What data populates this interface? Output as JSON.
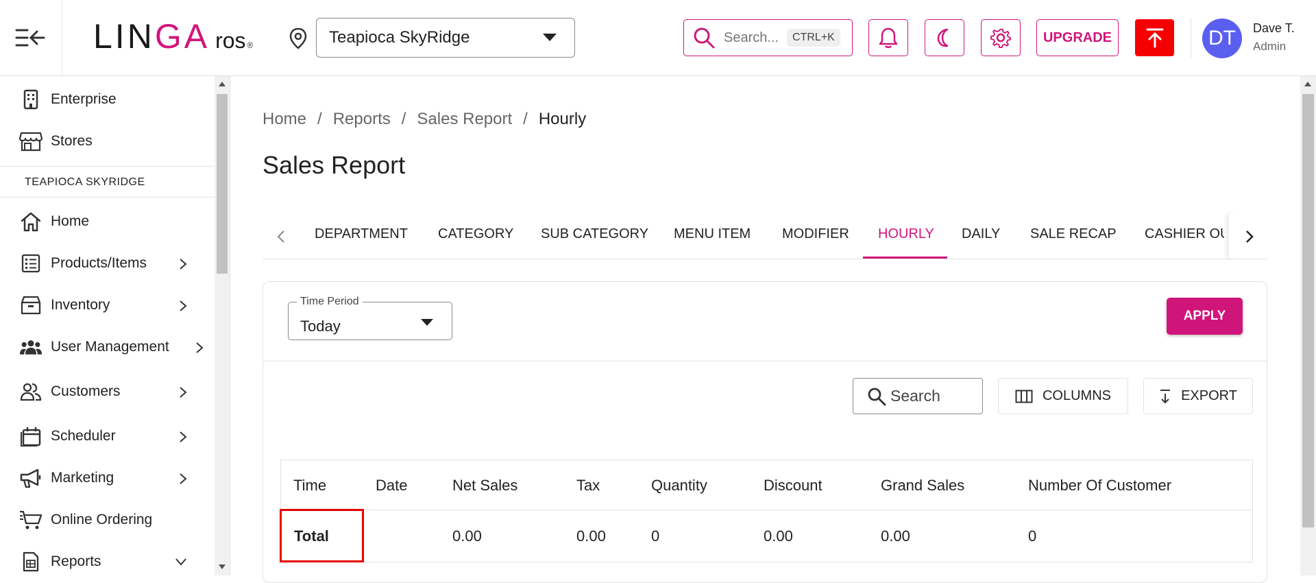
{
  "header": {
    "logo": {
      "brand_prefix": "LIN",
      "brand_accent": "GA",
      "product": "ros",
      "registered": "®"
    },
    "store_selector": {
      "value": "Teapioca SkyRidge"
    },
    "search": {
      "placeholder": "Search...",
      "shortcut": "CTRL+K"
    },
    "upgrade_label": "UPGRADE",
    "user": {
      "initials": "DT",
      "name": "Dave T.",
      "role": "Admin"
    }
  },
  "sidebar": {
    "top_items": [
      {
        "label": "Enterprise",
        "icon": "building-icon"
      },
      {
        "label": "Stores",
        "icon": "store-icon"
      }
    ],
    "store_section": "TEAPIOCA SKYRIDGE",
    "items": [
      {
        "label": "Home",
        "icon": "home-icon"
      },
      {
        "label": "Products/Items",
        "icon": "list-icon"
      },
      {
        "label": "Inventory",
        "icon": "box-icon"
      },
      {
        "label": "User Management",
        "icon": "users-icon"
      },
      {
        "label": "Customers",
        "icon": "customers-icon"
      },
      {
        "label": "Scheduler",
        "icon": "calendar-icon"
      },
      {
        "label": "Marketing",
        "icon": "megaphone-icon"
      },
      {
        "label": "Online Ordering",
        "icon": "cart-icon"
      },
      {
        "label": "Reports",
        "icon": "report-icon"
      }
    ]
  },
  "breadcrumb": [
    "Home",
    "Reports",
    "Sales Report",
    "Hourly"
  ],
  "page_title": "Sales Report",
  "tabs": [
    "DEPARTMENT",
    "CATEGORY",
    "SUB CATEGORY",
    "MENU ITEM",
    "MODIFIER",
    "HOURLY",
    "DAILY",
    "SALE RECAP",
    "CASHIER OUT"
  ],
  "active_tab": "HOURLY",
  "filters": {
    "time_period": {
      "label": "Time Period",
      "value": "Today"
    },
    "apply_label": "APPLY"
  },
  "grid_toolbar": {
    "search_placeholder": "Search",
    "columns_label": "COLUMNS",
    "export_label": "EXPORT"
  },
  "table": {
    "columns": [
      "Time",
      "Date",
      "Net Sales",
      "Tax",
      "Quantity",
      "Discount",
      "Grand Sales",
      "Number Of Customer"
    ],
    "total_row": [
      "Total",
      "",
      "0.00",
      "0.00",
      "0",
      "0.00",
      "0.00",
      "0"
    ]
  },
  "colors": {
    "accent": "#d0157a",
    "publish": "#f50000",
    "avatar": "#5b5ff0",
    "highlight": "#e60000"
  }
}
